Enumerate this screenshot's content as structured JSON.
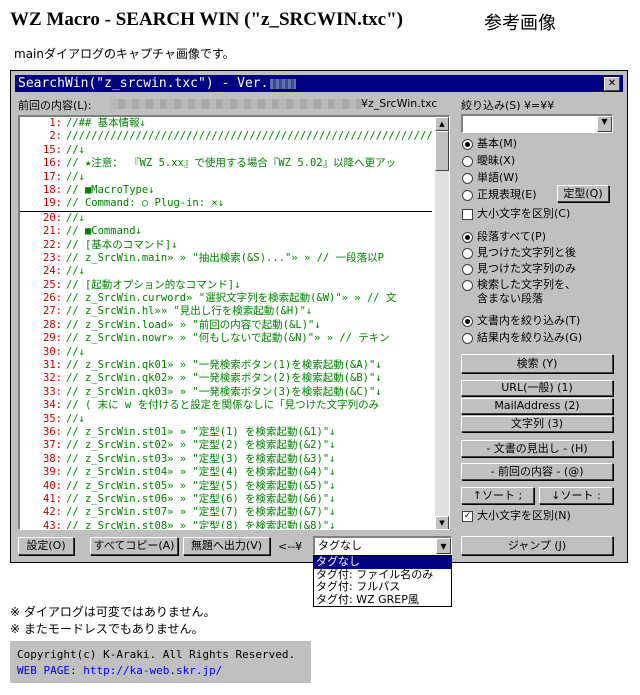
{
  "page": {
    "title": "WZ Macro - SEARCH WIN (\"z_SRCWIN.txc\")",
    "ref_title": "参考画像",
    "subtitle": "mainダイアログのキャプチャ画像です。"
  },
  "dialog": {
    "title": "SearchWin(\"z_srcwin.txc\") - Ver.",
    "close_glyph": "✕",
    "prev_content_label": "前回の内容(L):",
    "prev_content_path": "¥z_SrcWin.txc",
    "filter_label": "絞り込み(S) ¥=¥¥",
    "filter_value": "",
    "radio_match": [
      {
        "label": "基本(M)",
        "checked": true
      },
      {
        "label": "曖昧(X)",
        "checked": false
      },
      {
        "label": "単語(W)",
        "checked": false
      },
      {
        "label": "正規表現(E)",
        "checked": false
      }
    ],
    "teikei_button": "定型(Q)",
    "case_check_top": "大小文字を区別(C)",
    "radio_scope": [
      {
        "label": "段落すべて(P)",
        "checked": true
      },
      {
        "label": "見つけた文字列と後",
        "checked": false
      },
      {
        "label": "見つけた文字列のみ",
        "checked": false
      },
      {
        "label": "検索した文字列を、",
        "label2": "含まない段落",
        "checked": false
      }
    ],
    "radio_target": [
      {
        "label": "文書内を絞り込み(T)",
        "checked": true
      },
      {
        "label": "結果内を絞り込み(G)",
        "checked": false
      }
    ],
    "search_button": "検索 (Y)",
    "url_button": "URL(一般) (1)",
    "mail_button": "MailAddress (2)",
    "string_button": "文字列 (3)",
    "heading_button": "- 文書の見出し - (H)",
    "prev_button": "- 前回の内容 - (@)",
    "sort_asc": "↑ソート ;",
    "sort_desc": "↓ソート :",
    "case_check_bottom": "大小文字を区別(N)",
    "jump_button": "ジャンプ (J)",
    "settings_button": "設定(O)",
    "copy_all_button": "すべてコピー(A)",
    "no_title_button": "無題へ出力(V)",
    "arrow_label": "<--¥",
    "tag_select_value": "タグなし",
    "tag_options": [
      "タグなし",
      "タグ付: ファイル名のみ",
      "タグ付: フルパス",
      "タグ付: WZ GREP風"
    ]
  },
  "code_lines": [
    {
      "n": "1:",
      "t": "//## 基本情報↓",
      "kw": ""
    },
    {
      "n": "2:",
      "t": "/////////////////////////////////////////////////////////////",
      "kw": ""
    },
    {
      "n": "15:",
      "t": "//↓",
      "kw": ""
    },
    {
      "n": "16:",
      "t": "// ★注意： 『WZ 5.xx』で使用する場合『WZ 5.02』以降へ更アッ",
      "kw": ""
    },
    {
      "n": "17:",
      "t": "//↓",
      "kw": ""
    },
    {
      "n": "18:",
      "t": "// ■MacroType↓",
      "kw": ""
    },
    {
      "n": "19:",
      "t": "//   Command: ○  Plug-in: ×↓",
      "kw": ""
    },
    {
      "n": "20:",
      "t": "//↓",
      "kw": ""
    },
    {
      "n": "21:",
      "t": "// ■Command↓",
      "kw": ""
    },
    {
      "n": "22:",
      "t": "//   [基本のコマンド]↓",
      "kw": ""
    },
    {
      "n": "23:",
      "t": "//   z_SrcWin.main»  »   \"抽出検索(&S)...\"»  »   // 一段落以P",
      "kw": ""
    },
    {
      "n": "24:",
      "t": "//↓",
      "kw": ""
    },
    {
      "n": "25:",
      "t": "//   [起動オプション的なコマンド]↓",
      "kw": ""
    },
    {
      "n": "26:",
      "t": "//   z_SrcWin.curword»   \"選択文字列を検索起動(&W)\"»  »   // 文",
      "kw": ""
    },
    {
      "n": "27:",
      "t": "//   z_SrcWin.hl»»   \"見出し行を検索起動(&H)\"↓",
      "kw": ""
    },
    {
      "n": "28:",
      "t": "//   z_SrcWin.load»  »   \"前回の内容で起動(&L)\"↓",
      "kw": ""
    },
    {
      "n": "29:",
      "t": "//   z_SrcWin.nowr»  »   \"何もしないで起動(&N)\"»  »   // テキン",
      "kw": ""
    },
    {
      "n": "30:",
      "t": "//↓",
      "kw": ""
    },
    {
      "n": "31:",
      "t": "//   z_SrcWin.qk01»  »   \"一発検索ボタン(1)を検索起動(&A)\"↓",
      "kw": ""
    },
    {
      "n": "32:",
      "t": "//   z_SrcWin.qk02»  »   \"一発検索ボタン(2)を検索起動(&B)\"↓",
      "kw": ""
    },
    {
      "n": "33:",
      "t": "//   z_SrcWin.qk03»  »   \"一発検索ボタン(3)を検索起動(&C)\"↓",
      "kw": ""
    },
    {
      "n": "34:",
      "t": "//     ( 末に w を付けると設定を関係なしに「見つけた文字列のみ",
      "kw": ""
    },
    {
      "n": "35:",
      "t": "//↓",
      "kw": ""
    },
    {
      "n": "36:",
      "t": "//   z_SrcWin.st01»  »   \"定型(1) を検索起動(&1)\"↓",
      "kw": ""
    },
    {
      "n": "37:",
      "t": "//   z_SrcWin.st02»  »   \"定型(2) を検索起動(&2)\"↓",
      "kw": ""
    },
    {
      "n": "38:",
      "t": "//   z_SrcWin.st03»  »   \"定型(3) を検索起動(&3)\"↓",
      "kw": ""
    },
    {
      "n": "39:",
      "t": "//   z_SrcWin.st04»  »   \"定型(4) を検索起動(&4)\"↓",
      "kw": ""
    },
    {
      "n": "40:",
      "t": "//   z_SrcWin.st05»  »   \"定型(5) を検索起動(&5)\"↓",
      "kw": ""
    },
    {
      "n": "41:",
      "t": "//   z_SrcWin.st06»  »   \"定型(6) を検索起動(&6)\"↓",
      "kw": ""
    },
    {
      "n": "42:",
      "t": "//   z_SrcWin.st07»  »   \"定型(7) を検索起動(&7)\"↓",
      "kw": ""
    },
    {
      "n": "43:",
      "t": "//   z_SrcWin.st08»  »   \"定型(8) を検索起動(&8)\"↓",
      "kw": ""
    },
    {
      "n": "44:",
      "t": "//   z_SrcWin.st09»  »   \"定型(9) を検索起動(&9)\"↓",
      "kw": ""
    }
  ],
  "notes": [
    "※  ダイアログは可変ではありません。",
    "※  またモードレスでもありません。"
  ],
  "footer": {
    "copyright": "Copyright(c) K-Araki. All Rights Reserved.",
    "web_label": "WEB PAGE: ",
    "web_url": "http://ka-web.skr.jp/"
  }
}
